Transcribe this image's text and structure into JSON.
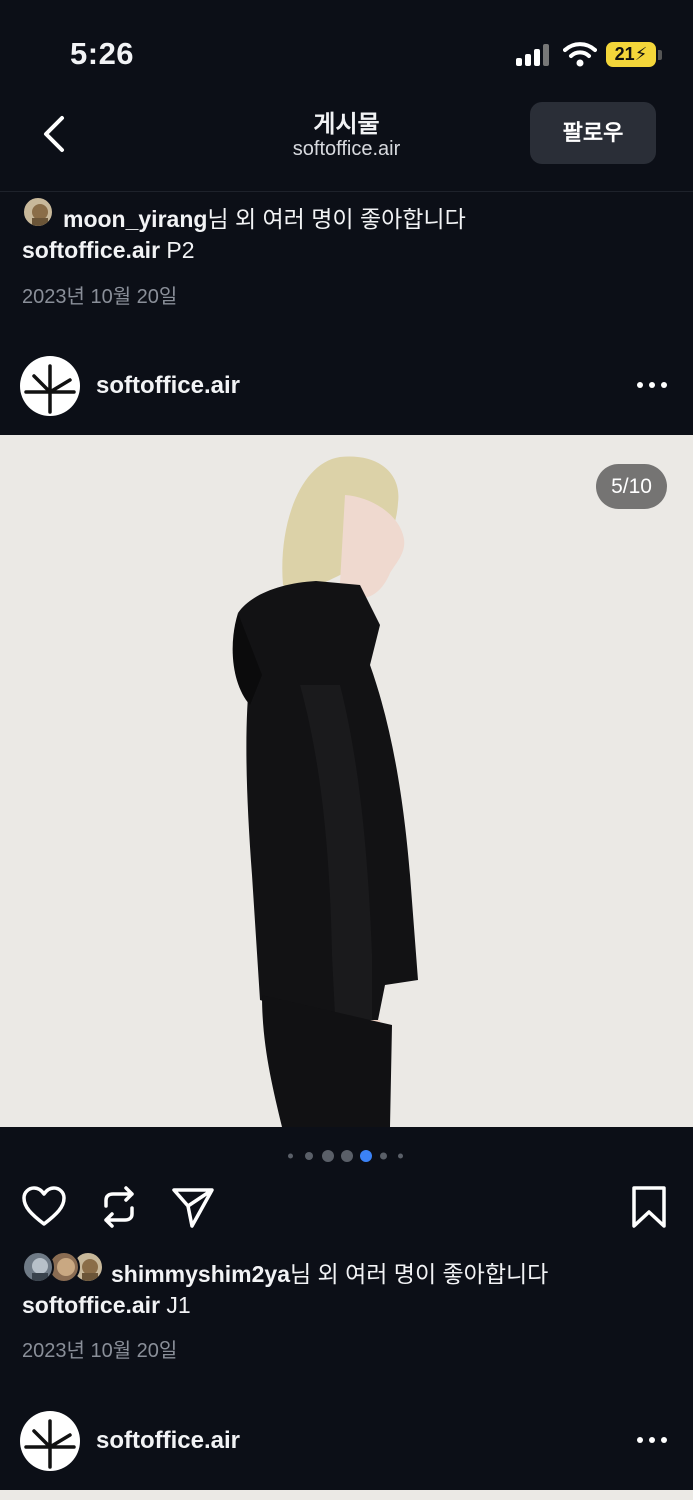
{
  "status_bar": {
    "time": "5:26",
    "battery": "21"
  },
  "nav": {
    "title": "게시물",
    "subtitle": "softoffice.air",
    "follow_label": "팔로우"
  },
  "prev_post": {
    "liked_by": "moon_yirang",
    "liked_suffix": "님 외 여러 명이 좋아합니다",
    "caption_user": "softoffice.air",
    "caption_text": " P2",
    "date": "2023년 10월 20일"
  },
  "post": {
    "username": "softoffice.air",
    "counter": "5/10",
    "carousel": {
      "total_dots": 7,
      "active_dot": 4
    },
    "liked_by": "shimmyshim2ya",
    "liked_suffix": "님 외 여러 명이 좋아합니다",
    "caption_user": "softoffice.air",
    "caption_text": " J1",
    "date": "2023년 10월 20일"
  },
  "next_post": {
    "username": "softoffice.air"
  },
  "icons": {
    "back": "chevron-left-icon",
    "more": "more-horizontal-icon",
    "like": "heart-icon",
    "repost": "repost-icon",
    "share": "send-icon",
    "save": "bookmark-icon"
  },
  "colors": {
    "background": "#0c0f17",
    "button": "#2a2e37",
    "active_dot": "#3b82f6",
    "battery": "#f4d63a"
  }
}
